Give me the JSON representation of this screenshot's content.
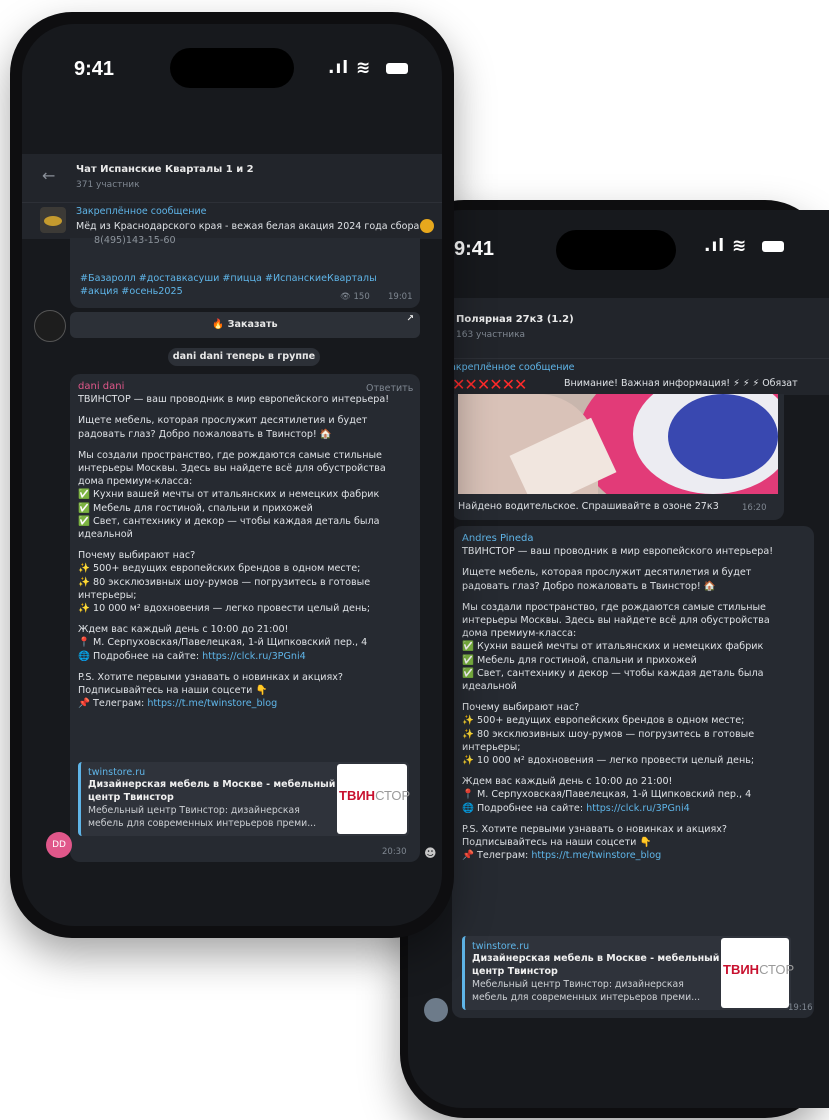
{
  "phone1": {
    "status_time": "9:41",
    "chat_title": "Чат Испанские Кварталы 1 и 2",
    "chat_subtitle": "371 участник",
    "pinned_label": "Закреплённое сообщение",
    "pinned_text": "Мёд из Краснодарского края - вежая белая акация 2024 года сбора",
    "prev_phone_fragment": "8(495)143-15-60",
    "prev_hashtags_line1": "#Базаролл #доставкасуши #пицца #ИспанскиеКварталы",
    "prev_hashtags_line2": "#акция #осень2025",
    "prev_views": "150",
    "prev_time": "19:01",
    "order_button": "Заказать",
    "service_message": "dani dani теперь в группе",
    "author": "dani dani",
    "reply_label": "Ответить",
    "message_time": "20:30",
    "avatar_initials": "DD"
  },
  "phone2": {
    "status_time": "9:41",
    "chat_title": "Полярная 27к3 (1.2)",
    "chat_subtitle": "163 участника",
    "pinned_label": "Закреплённое сообщение",
    "pinned_text": "Внимание! Важная информация! ⚡ ⚡ ⚡ Обязат",
    "photo_caption": "Найдено водительское. Спрашивайте в озоне 27к3",
    "photo_time": "16:20",
    "author": "Andres Pineda",
    "message_time": "19:16"
  },
  "message": {
    "line1": "ТВИНСТОР — ваш проводник в мир европейского интерьера!",
    "p2_l1": "Ищете мебель, которая прослужит десятилетия и будет",
    "p2_l2": "радовать глаз? Добро пожаловать в Твинстор! 🏠",
    "p3_l1": "Мы создали пространство, где рождаются самые стильные",
    "p3_l2": "интерьеры Москвы. Здесь вы найдете всё для обустройства",
    "p3_l3": "дома премиум-класса:",
    "b1": "Кухни вашей мечты от итальянских и немецких фабрик",
    "b2": "Мебель для гостиной, спальни и прихожей",
    "b3_l1": "Свет, сантехнику и декор — чтобы каждая деталь была",
    "b3_l2": "идеальной",
    "why": "Почему выбирают нас?",
    "s1": "500+ ведущих европейских брендов в одном месте;",
    "s2_l1": "80 эксклюзивных шоу-румов — погрузитесь в готовые",
    "s2_l2": "интерьеры;",
    "s3": "10 000 м² вдохновения — легко провести целый день;",
    "wait": "Ждем вас каждый день с 10:00 до 21:00!",
    "address": "М. Серпуховская/Павелецкая, 1-й Щипковский пер., 4",
    "site_label": "Подробнее на сайте: ",
    "site_link": "https://clck.ru/3PGni4",
    "ps_l1": "P.S. Хотите первыми узнавать о новинках и акциях?",
    "ps_l2": "Подписывайтесь на наши соцсети 👇",
    "tg_label": "Телеграм: ",
    "tg_link": "https://t.me/twinstore_blog"
  },
  "preview": {
    "site": "twinstore.ru",
    "title_l1": "Дизайнерская мебель в Москве - мебельный",
    "title_l2": "центр Твинстор",
    "desc_l1": "Мебельный центр Твинстор: дизайнерская",
    "desc_l2": "мебель для современных интерьеров преми...",
    "logo_bold": "ТВИН",
    "logo_light": "СТОР"
  },
  "icons": {
    "back": "back-arrow-icon",
    "check": "checkbox-icon",
    "sparkles": "sparkles-icon",
    "pin": "location-pin-icon",
    "globe": "globe-icon",
    "telegram": "telegram-icon",
    "fire": "fire-icon"
  },
  "colors": {
    "screen_bg": "#17191d",
    "bubble_bg": "#262a31",
    "link": "#5fb5e8",
    "author_pink": "#e0578a",
    "check_green": "#4cae4f"
  }
}
